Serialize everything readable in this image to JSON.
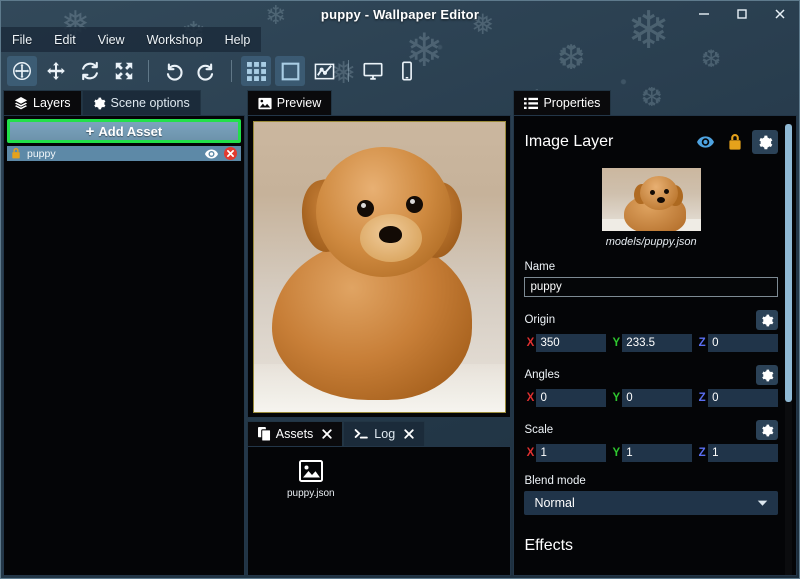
{
  "window": {
    "title": "puppy - Wallpaper Editor",
    "controls": [
      {
        "name": "minimize",
        "label": "—"
      },
      {
        "name": "maximize",
        "label": "□"
      },
      {
        "name": "close",
        "label": "✕"
      }
    ]
  },
  "menubar": {
    "items": [
      {
        "label": "File"
      },
      {
        "label": "Edit"
      },
      {
        "label": "View"
      },
      {
        "label": "Workshop"
      },
      {
        "label": "Help"
      }
    ]
  },
  "toolbar": {
    "buttons": [
      {
        "name": "select-tool",
        "icon": "move-target-icon",
        "active": true
      },
      {
        "name": "translate-tool",
        "icon": "arrows-move-icon",
        "active": false
      },
      {
        "name": "rotate-tool",
        "icon": "rotate-icon",
        "active": false
      },
      {
        "name": "scale-tool",
        "icon": "scale-icon",
        "active": false
      },
      {
        "name": "undo",
        "icon": "undo-icon",
        "active": false
      },
      {
        "name": "redo",
        "icon": "redo-icon",
        "active": false
      },
      {
        "name": "grid-toggle",
        "icon": "grid-icon",
        "active": true
      },
      {
        "name": "bounds-toggle",
        "icon": "square-outline-icon",
        "active": true
      },
      {
        "name": "stats-toggle",
        "icon": "chart-line-icon",
        "active": false
      },
      {
        "name": "preview-desktop",
        "icon": "monitor-icon",
        "active": false
      },
      {
        "name": "preview-mobile",
        "icon": "phone-icon",
        "active": false
      }
    ]
  },
  "left_panel": {
    "tabs": [
      {
        "label": "Layers",
        "icon": "layers-icon",
        "active": true
      },
      {
        "label": "Scene options",
        "icon": "gear-icon",
        "active": false
      }
    ],
    "add_asset_label": "Add Asset",
    "add_asset_plus": "+",
    "highlight_color": "#22e04a",
    "layers": [
      {
        "name": "puppy",
        "locked": true,
        "visible": true
      }
    ]
  },
  "preview_panel": {
    "tabs": [
      {
        "label": "Preview",
        "icon": "image-icon",
        "active": true
      }
    ]
  },
  "assets_panel": {
    "tabs": [
      {
        "label": "Assets",
        "icon": "copy-icon",
        "active": true,
        "closable": true
      },
      {
        "label": "Log",
        "icon": "terminal-icon",
        "active": false,
        "closable": true
      }
    ],
    "items": [
      {
        "label": "puppy.json",
        "icon": "image-file-icon"
      }
    ]
  },
  "properties": {
    "tabs": [
      {
        "label": "Properties",
        "icon": "list-icon",
        "active": true
      }
    ],
    "header": {
      "title": "Image Layer",
      "actions": [
        {
          "name": "visibility-toggle",
          "icon": "eye-icon",
          "color": "#4ea3e0"
        },
        {
          "name": "lock-toggle",
          "icon": "lock-icon",
          "color": "#e5a21b"
        },
        {
          "name": "layer-settings",
          "icon": "gear-icon",
          "color": "#ffffff"
        }
      ]
    },
    "thumbnail_caption": "models/puppy.json",
    "name_field": {
      "label": "Name",
      "value": "puppy"
    },
    "origin": {
      "label": "Origin",
      "x": "350",
      "y": "233.5",
      "z": "0",
      "axis_x": "X",
      "axis_y": "Y",
      "axis_z": "Z"
    },
    "angles": {
      "label": "Angles",
      "x": "0",
      "y": "0",
      "z": "0",
      "axis_x": "X",
      "axis_y": "Y",
      "axis_z": "Z"
    },
    "scale": {
      "label": "Scale",
      "x": "1",
      "y": "1",
      "z": "1",
      "axis_x": "X",
      "axis_y": "Y",
      "axis_z": "Z"
    },
    "blend_mode": {
      "label": "Blend mode",
      "value": "Normal"
    },
    "effects_label": "Effects"
  }
}
